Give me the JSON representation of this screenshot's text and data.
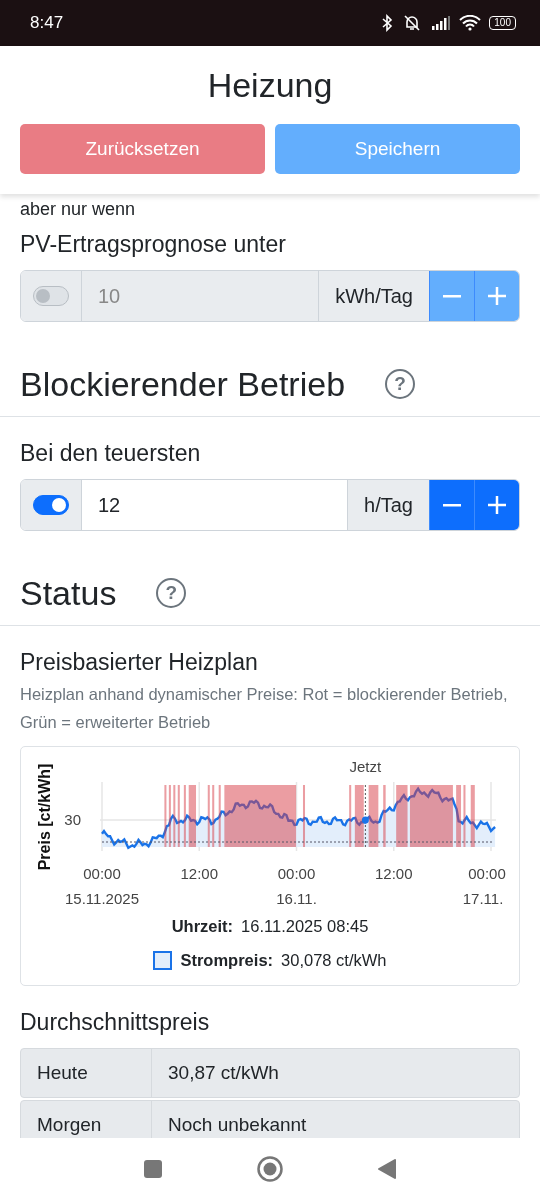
{
  "status_bar": {
    "time": "8:47",
    "battery": "100"
  },
  "header": {
    "title": "Heizung",
    "buttons": [
      {
        "label": "Zurücksetzen",
        "kind": "reset"
      },
      {
        "label": "Speichern",
        "kind": "save"
      }
    ]
  },
  "pv_condition": {
    "caption": "aber nur wenn",
    "label": "PV-Ertragsprognose unter",
    "control": {
      "on": false,
      "value": "10",
      "unit": "kWh/Tag"
    }
  },
  "blocking": {
    "heading": "Blockierender Betrieb",
    "help": "?",
    "label": "Bei den teuersten",
    "control": {
      "on": true,
      "value": "12",
      "unit": "h/Tag"
    }
  },
  "status": {
    "heading": "Status",
    "help": "?",
    "plan_title": "Preisbasierter Heizplan",
    "plan_description": "Heizplan anhand dynamischer Preise: Rot = blockierender Betrieb, Grün = erweiterter Betrieb",
    "chart": {
      "now_label": "Jetzt",
      "y_axis_label": "Preis [ct/kWh]",
      "y_tick": "30",
      "x_ticks": [
        {
          "time": "00:00",
          "date": "15.11.2025"
        },
        {
          "time": "12:00"
        },
        {
          "time": "00:00",
          "date": "16.11."
        },
        {
          "time": "12:00"
        },
        {
          "time": "00:00",
          "date": "17.11."
        }
      ],
      "time_label": "Uhrzeit:",
      "time_value": "16.11.2025 08:45",
      "legend_label": "Strompreis:",
      "legend_value": "30,078 ct/kWh"
    },
    "average_title": "Durchschnittspreis",
    "average_rows": [
      {
        "label": "Heute",
        "value": "30,87 ct/kWh"
      },
      {
        "label": "Morgen",
        "value": "Noch unbekannt"
      }
    ]
  }
}
